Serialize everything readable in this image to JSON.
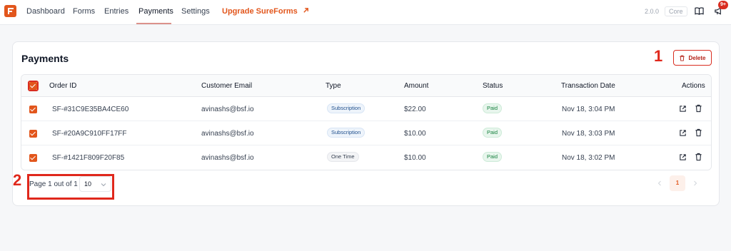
{
  "nav": {
    "items": [
      "Dashboard",
      "Forms",
      "Entries",
      "Payments",
      "Settings"
    ],
    "upgrade_label": "Upgrade SureForms",
    "version": "2.0.0",
    "plan_badge": "Core",
    "notification_count": "9+"
  },
  "page": {
    "title": "Payments",
    "delete_label": "Delete"
  },
  "table": {
    "columns": [
      "Order ID",
      "Customer Email",
      "Type",
      "Amount",
      "Status",
      "Transaction Date",
      "Actions"
    ],
    "rows": [
      {
        "order_id": "SF-#31C9E35BA4CE60",
        "email": "avinashs@bsf.io",
        "type": "Subscription",
        "amount": "$22.00",
        "status": "Paid",
        "date": "Nov 18, 3:04 PM"
      },
      {
        "order_id": "SF-#20A9C910FF17FF",
        "email": "avinashs@bsf.io",
        "type": "Subscription",
        "amount": "$10.00",
        "status": "Paid",
        "date": "Nov 18, 3:03 PM"
      },
      {
        "order_id": "SF-#1421F809F20F85",
        "email": "avinashs@bsf.io",
        "type": "One Time",
        "amount": "$10.00",
        "status": "Paid",
        "date": "Nov 18, 3:02 PM"
      }
    ]
  },
  "pagination": {
    "page_text": "Page 1 out of 1",
    "per_page": "10",
    "current_page": "1"
  },
  "annotations": [
    "1",
    "2"
  ],
  "colors": {
    "accent": "#e2561c",
    "danger": "#d92d20",
    "paid": "#15803d",
    "annotation": "#e0281c"
  }
}
